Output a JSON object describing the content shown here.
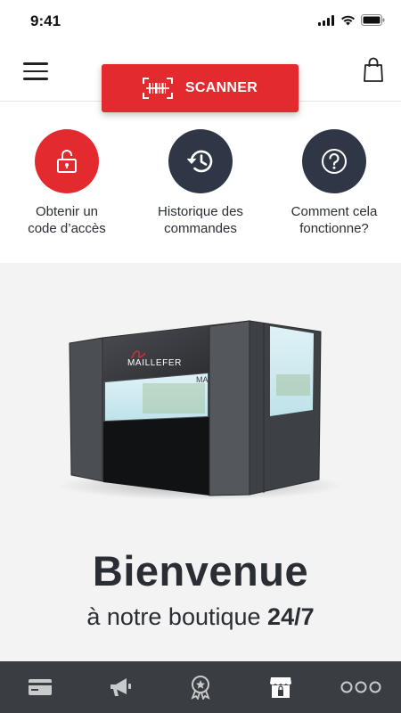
{
  "status": {
    "time": "9:41"
  },
  "header": {
    "scanner_label": "SCANNER"
  },
  "actions": [
    {
      "label": "Obtenir un\ncode d’accès",
      "icon": "unlock-icon",
      "color": "#e32b2f"
    },
    {
      "label": "Historique des\ncommandes",
      "icon": "history-icon",
      "color": "#2f3746"
    },
    {
      "label": "Comment cela\nfonctionne?",
      "icon": "question-icon",
      "color": "#2f3746"
    }
  ],
  "hero": {
    "brand": "MAILLEFER",
    "brand_partial": "MA",
    "title": "Bienvenue",
    "subtitle_prefix": "à notre boutique ",
    "subtitle_bold": "24/7"
  },
  "bottom_nav": {
    "items": [
      "card-icon",
      "megaphone-icon",
      "award-icon",
      "store-icon",
      "more-icon"
    ],
    "active": "store-icon"
  },
  "colors": {
    "accent": "#e32b2f",
    "dark": "#2f3746",
    "nav_bg": "#3a3d42"
  }
}
